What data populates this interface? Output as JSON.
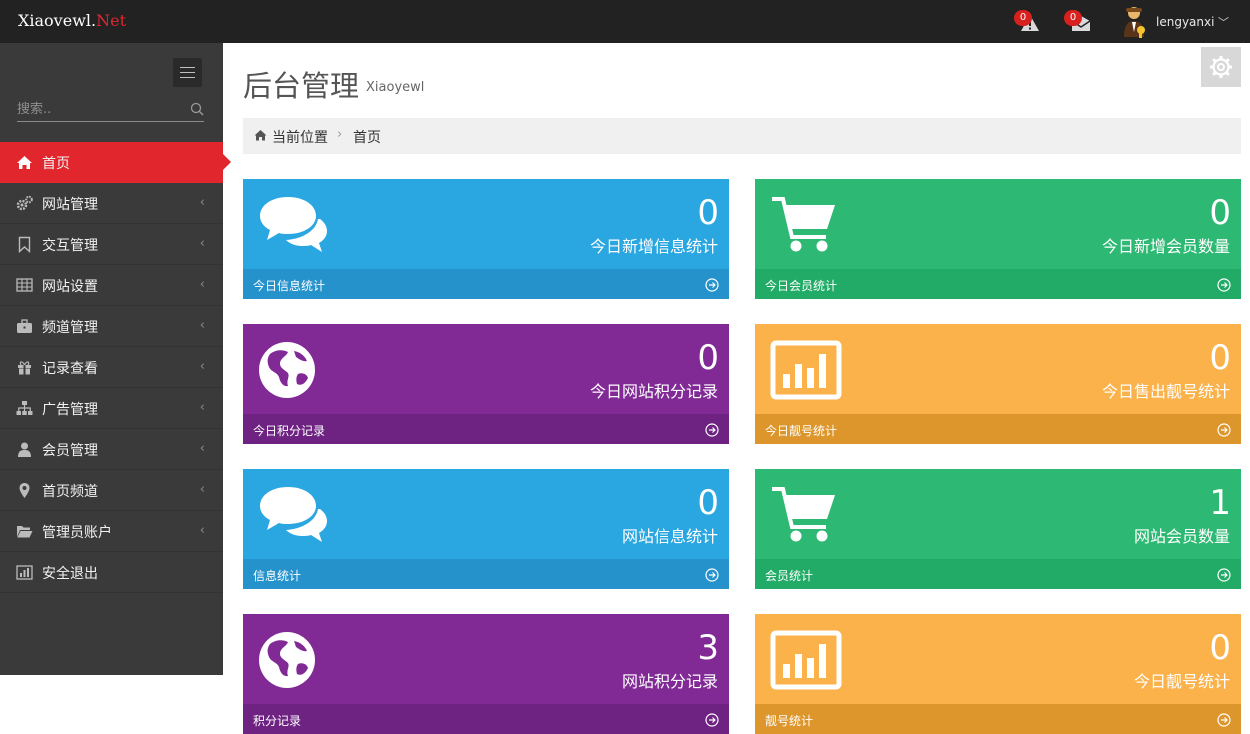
{
  "header": {
    "brand_main": "Xiaovewl.",
    "brand_accent": "Net",
    "alerts_count": "0",
    "messages_count": "0",
    "username": "lengyanxi",
    "user_caret": "﹀"
  },
  "sidebar": {
    "search_placeholder": "搜索..",
    "items": [
      {
        "label": "首页",
        "icon": "home-icon",
        "active": true
      },
      {
        "label": "网站管理",
        "icon": "cogs-icon"
      },
      {
        "label": "交互管理",
        "icon": "bookmark-icon"
      },
      {
        "label": "网站设置",
        "icon": "table-icon"
      },
      {
        "label": "频道管理",
        "icon": "briefcase-icon"
      },
      {
        "label": "记录查看",
        "icon": "gift-icon"
      },
      {
        "label": "广告管理",
        "icon": "sitemap-icon"
      },
      {
        "label": "会员管理",
        "icon": "user-icon"
      },
      {
        "label": "首页频道",
        "icon": "map-marker-icon"
      },
      {
        "label": "管理员账户",
        "icon": "folder-open-icon"
      },
      {
        "label": "安全退出",
        "icon": "bar-chart-icon"
      }
    ],
    "chevron": "‹"
  },
  "page": {
    "title": "后台管理",
    "subtitle": "Xiaoyewl"
  },
  "breadcrumb": {
    "current_label": "当前位置",
    "separator": "›",
    "page": "首页"
  },
  "tiles": [
    {
      "value": "0",
      "label": "今日新增信息统计",
      "footer": "今日信息统计",
      "color": "blue",
      "icon": "comments-icon"
    },
    {
      "value": "0",
      "label": "今日新增会员数量",
      "footer": "今日会员统计",
      "color": "green",
      "icon": "shopping-cart-icon"
    },
    {
      "value": "0",
      "label": "今日网站积分记录",
      "footer": "今日积分记录",
      "color": "purple",
      "icon": "globe-icon"
    },
    {
      "value": "0",
      "label": "今日售出靓号统计",
      "footer": "今日靓号统计",
      "color": "orange",
      "icon": "bar-chart-icon"
    },
    {
      "value": "0",
      "label": "网站信息统计",
      "footer": "信息统计",
      "color": "blue",
      "icon": "comments-icon"
    },
    {
      "value": "1",
      "label": "网站会员数量",
      "footer": "会员统计",
      "color": "green",
      "icon": "shopping-cart-icon"
    },
    {
      "value": "3",
      "label": "网站积分记录",
      "footer": "积分记录",
      "color": "purple",
      "icon": "globe-icon"
    },
    {
      "value": "0",
      "label": "今日靓号统计",
      "footer": "靓号统计",
      "color": "orange",
      "icon": "bar-chart-icon"
    }
  ]
}
